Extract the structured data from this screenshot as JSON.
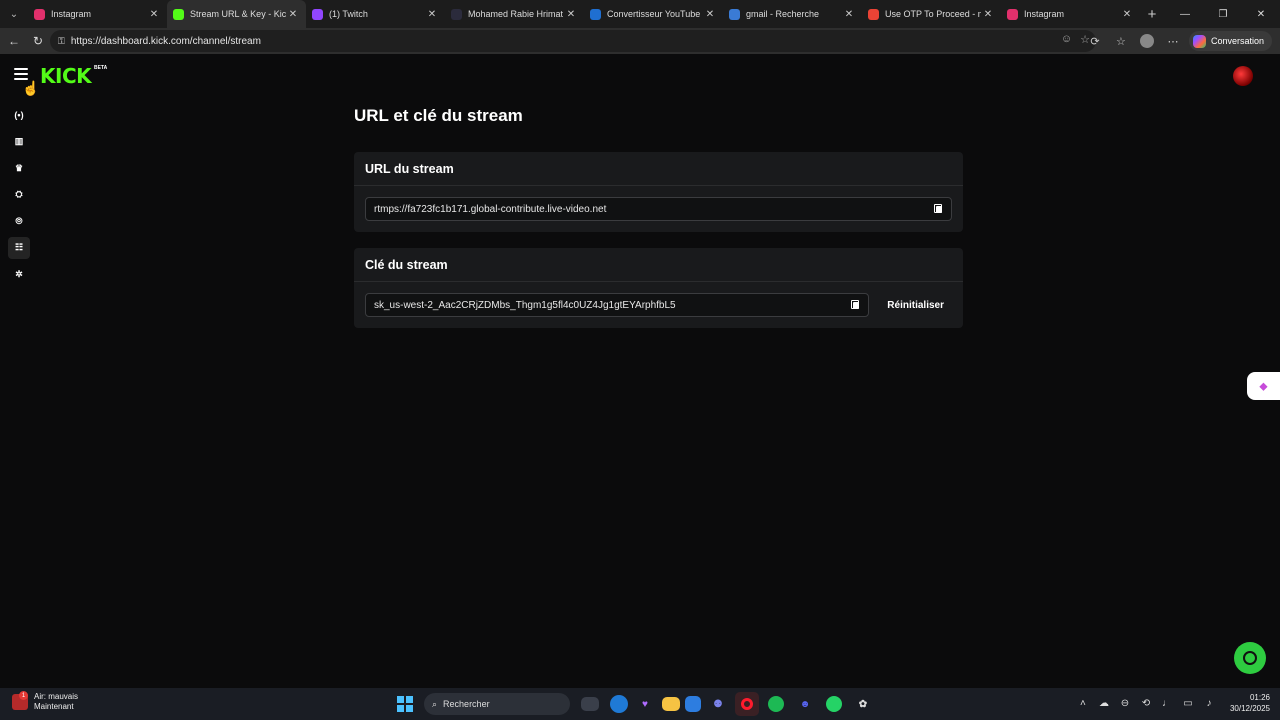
{
  "browser": {
    "tabs": [
      {
        "label": "Instagram",
        "icon": "instagram-icon",
        "color": "#e1306c",
        "active": false
      },
      {
        "label": "Stream URL & Key - Kick Da",
        "icon": "kick-icon",
        "color": "#53fc18",
        "active": true
      },
      {
        "label": "(1) Twitch",
        "icon": "twitch-icon",
        "color": "#9146ff",
        "active": false
      },
      {
        "label": "Mohamed Rabie Hrimat - Re",
        "icon": "page-icon",
        "color": "#2b2b3c",
        "active": false
      },
      {
        "label": "Convertisseur YouTube en M",
        "icon": "converter-icon",
        "color": "#1f6fd1",
        "active": false
      },
      {
        "label": "gmail - Recherche",
        "icon": "search-icon",
        "color": "#3a7bd5",
        "active": false
      },
      {
        "label": "Use OTP To Proceed - moua",
        "icon": "gmail-icon",
        "color": "#ea4335",
        "active": false
      },
      {
        "label": "Instagram",
        "icon": "instagram-icon",
        "color": "#e1306c",
        "active": false
      }
    ],
    "url": "https://dashboard.kick.com/channel/stream",
    "conversation_label": "Conversation"
  },
  "kick": {
    "logo": "KICK",
    "logo_badge": "BETA",
    "brand_color": "#53fc18",
    "sidebar": [
      {
        "name": "live-icon",
        "glyph": "(•)"
      },
      {
        "name": "analytics-icon",
        "glyph": "▥"
      },
      {
        "name": "trophy-icon",
        "glyph": "♛"
      },
      {
        "name": "community-icon",
        "glyph": "⛭"
      },
      {
        "name": "stream-icon",
        "glyph": "⦾"
      },
      {
        "name": "channel-settings-icon",
        "glyph": "☷"
      },
      {
        "name": "settings-icon",
        "glyph": "✲"
      }
    ],
    "page_title": "URL et clé du stream",
    "url_card": {
      "title": "URL du stream",
      "value": "rtmps://fa723fc1b171.global-contribute.live-video.net"
    },
    "key_card": {
      "title": "Clé du stream",
      "value": "sk_us-west-2_Aac2CRjZDMbs_Thgm1g5fl4c0UZ4Jg1gtEYArphfbL5",
      "reset_label": "Réinitialiser"
    }
  },
  "taskbar": {
    "weather_title": "Air: mauvais",
    "weather_sub": "Maintenant",
    "weather_badge": "1",
    "search_placeholder": "Rechercher",
    "time": "01:26",
    "date": "30/12/2025"
  }
}
